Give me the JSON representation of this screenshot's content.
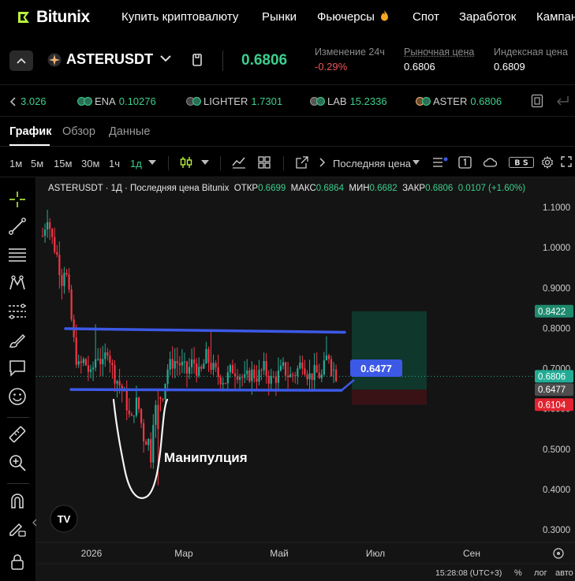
{
  "nav": {
    "logo_text": "Bitunix",
    "items": [
      "Купить криптовалюту",
      "Рынки",
      "Фьючерсы",
      "Спот",
      "Заработок",
      "Кампан"
    ]
  },
  "ticker": {
    "symbol": "ASTERUSDT",
    "last_price": "0.6806",
    "change_label": "Изменение 24ч",
    "change_value": "-0.29%",
    "market_label": "Рыночная цена",
    "market_value": "0.6806",
    "index_label": "Индексная цена",
    "index_value": "0.6809"
  },
  "strip": {
    "items": [
      {
        "name": "",
        "value": "3.026"
      },
      {
        "name": "ENA",
        "value": "0.10276"
      },
      {
        "name": "LIGHTER",
        "value": "1.7301"
      },
      {
        "name": "LAB",
        "value": "15.2336"
      },
      {
        "name": "ASTER",
        "value": "0.6806"
      }
    ]
  },
  "tabs": [
    "График",
    "Обзор",
    "Данные"
  ],
  "toolbar": {
    "timeframes": [
      "1м",
      "5м",
      "15м",
      "30м",
      "1ч",
      "1д"
    ],
    "active_timeframe": "1д",
    "price_type": "Последняя цена",
    "bs_label": "B S"
  },
  "chart": {
    "header_text": "ASTERUSDT · 1Д · Последняя цена Bitunix",
    "open_label": "ОТКР",
    "open": "0.6699",
    "high_label": "МАКС",
    "high": "0.6864",
    "low_label": "МИН",
    "low": "0.6682",
    "close_label": "ЗАКР",
    "close": "0.6806",
    "change": "0.0107 (+1.60%)",
    "annotation": "Манипулция",
    "callout": "0.6477",
    "clock": "15:28:08 (UTC+3)",
    "percent_btn": "%",
    "log_btn": "лог",
    "auto_btn": "авто",
    "tv_logo": "TV",
    "colors": {
      "up": "#22ab94",
      "down": "#f23645",
      "line": "#3c59e6",
      "bg": "#141414"
    }
  },
  "chart_data": {
    "type": "candlestick",
    "title": "ASTERUSDT · 1Д",
    "y_ticks": [
      "1.1000",
      "1.0000",
      "0.9000",
      "0.8000",
      "0.7000",
      "0.6000",
      "0.5000",
      "0.4000",
      "0.3000"
    ],
    "y_range": [
      0.26,
      1.19
    ],
    "x_ticks": [
      "2026",
      "Мар",
      "Май",
      "Июл",
      "Сен"
    ],
    "price_labels": [
      {
        "value": 0.8422,
        "text": "0.8422",
        "color": "#1e8a6e"
      },
      {
        "value": 0.6806,
        "text": "0.6806",
        "color": "#22ab94"
      },
      {
        "value": 0.6477,
        "text": "0.6477",
        "color": "#4d4d4d"
      },
      {
        "value": 0.6104,
        "text": "0.6104",
        "color": "#e0242f"
      }
    ],
    "channel": {
      "upper": [
        0.799,
        0.79
      ],
      "lower": [
        0.647,
        0.647
      ]
    },
    "position": {
      "entry": 0.6477,
      "target": 0.8422,
      "stop": 0.6104
    }
  }
}
